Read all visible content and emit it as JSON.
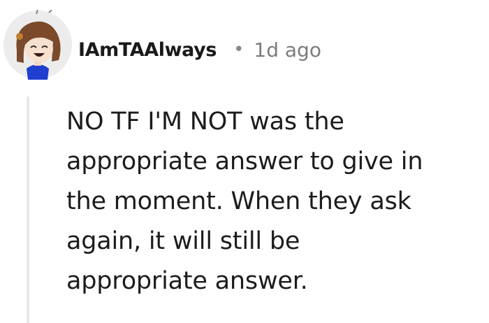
{
  "comment": {
    "username": "IAmTAAlways",
    "separator": "•",
    "timestamp": "1d ago",
    "avatar_icon": "cartoon-girl-avatar",
    "body_lines": [
      "NO TF I'M NOT was the",
      "appropriate answer to give in",
      "the moment. When they ask",
      "again, it will still be",
      "appropriate answer."
    ]
  },
  "colors": {
    "username": "#1a1a1b",
    "meta_gray": "#7c7c7c",
    "body_text": "#1c1c1c",
    "thread_line": "#e9e9e9",
    "avatar_background": "#f0f0f0",
    "avatar_hair": "#7a4a2a",
    "avatar_shirt": "#1f3fd1"
  }
}
